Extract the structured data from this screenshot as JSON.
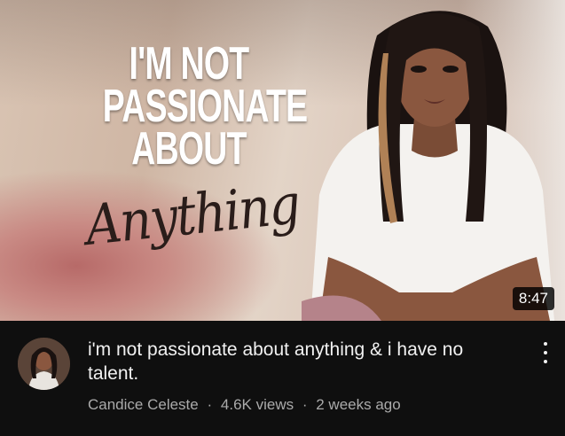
{
  "video": {
    "thumbnail": {
      "headline_lines": [
        "I'M NOT",
        "PASSIONATE",
        "ABOUT"
      ],
      "script_word": "Anything",
      "duration": "8:47"
    },
    "title": "i'm not passionate about anything & i have no talent.",
    "channel": "Candice Celeste",
    "separator": "·",
    "views": "4.6K views",
    "age": "2 weeks ago"
  },
  "icons": {
    "more": "more-vertical-icon"
  },
  "colors": {
    "background": "#0f0f0f",
    "title_text": "#f1f1f1",
    "meta_text": "#aaaaaa",
    "duration_bg": "#000000"
  }
}
